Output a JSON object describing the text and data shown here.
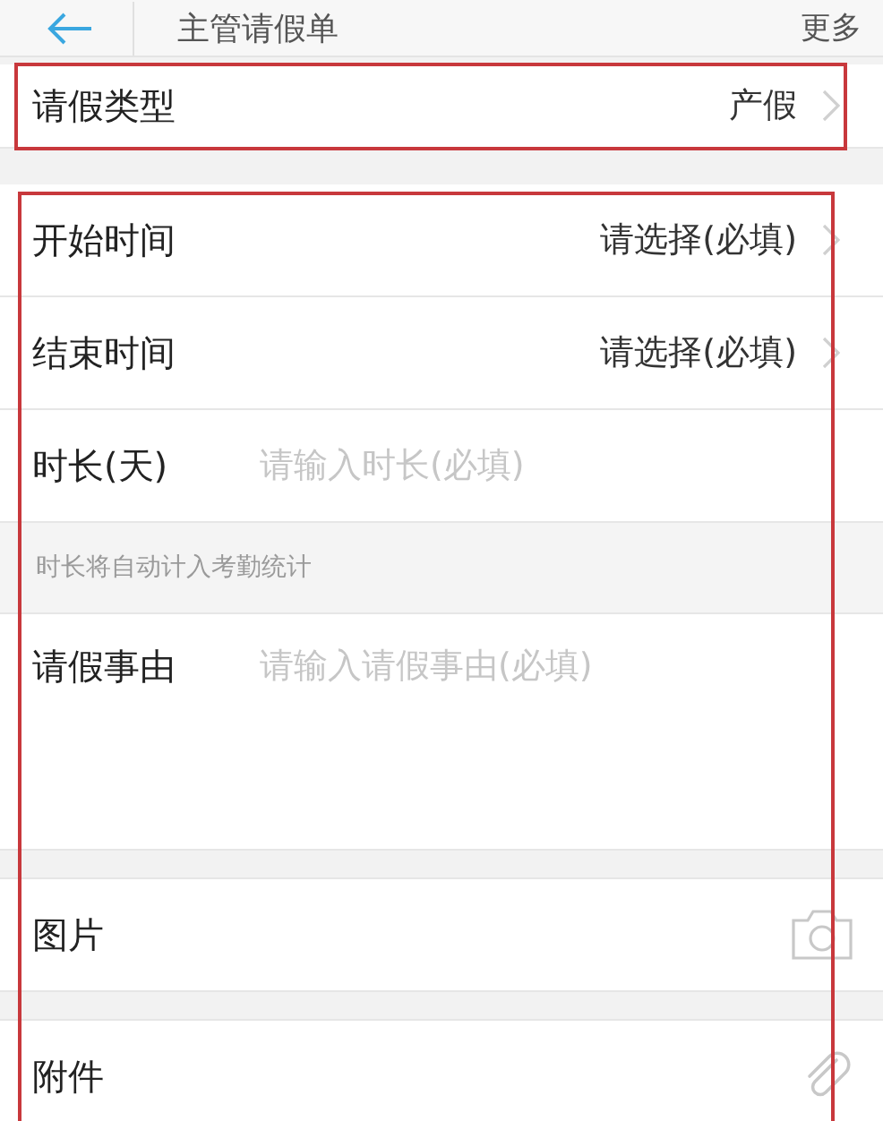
{
  "header": {
    "title": "主管请假单",
    "more": "更多"
  },
  "leave_type": {
    "label": "请假类型",
    "value": "产假",
    "highlighted": true
  },
  "details": {
    "highlighted": true,
    "rows": [
      {
        "kind": "select",
        "label": "开始时间",
        "value": "请选择(必填)"
      },
      {
        "kind": "select",
        "label": "结束时间",
        "value": "请选择(必填)"
      },
      {
        "kind": "input",
        "label": "时长(天)",
        "placeholder": "请输入时长(必填)"
      }
    ],
    "hint": "时长将自动计入考勤统计",
    "reason": {
      "label": "请假事由",
      "placeholder": "请输入请假事由(必填)"
    },
    "attachments": [
      {
        "kind": "image",
        "label": "图片"
      },
      {
        "kind": "file",
        "label": "附件"
      }
    ]
  }
}
